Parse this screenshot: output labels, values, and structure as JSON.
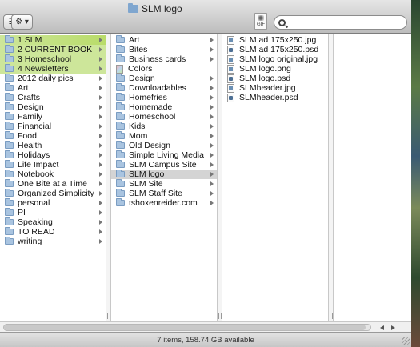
{
  "window": {
    "title": "SLM logo",
    "status": "7 items, 158.74 GB available"
  },
  "toolbar": {
    "view_label": "☰ ▾",
    "action_label": "⚙ ▾",
    "preview_badge": "GIF",
    "search_placeholder": "",
    "search_value": ""
  },
  "column1": {
    "items": [
      {
        "label": "1 SLM",
        "kind": "folder",
        "selected": true,
        "color": "green",
        "arrow": true
      },
      {
        "label": "2 CURRENT BOOK",
        "kind": "folder",
        "color": "green",
        "arrow": true
      },
      {
        "label": "3 Homeschool",
        "kind": "folder",
        "color": "green",
        "arrow": true
      },
      {
        "label": "4 Newsletters",
        "kind": "folder",
        "color": "green",
        "arrow": true
      },
      {
        "label": "2012 daily pics",
        "kind": "folder",
        "arrow": true
      },
      {
        "label": "Art",
        "kind": "folder",
        "arrow": true
      },
      {
        "label": "Crafts",
        "kind": "folder",
        "arrow": true
      },
      {
        "label": "Design",
        "kind": "folder",
        "arrow": true
      },
      {
        "label": "Family",
        "kind": "folder",
        "arrow": true
      },
      {
        "label": "Financial",
        "kind": "folder",
        "arrow": true
      },
      {
        "label": "Food",
        "kind": "folder",
        "arrow": true
      },
      {
        "label": "Health",
        "kind": "folder",
        "arrow": true
      },
      {
        "label": "Holidays",
        "kind": "folder",
        "arrow": true
      },
      {
        "label": "Life Impact",
        "kind": "folder",
        "arrow": true
      },
      {
        "label": "Notebook",
        "kind": "folder",
        "arrow": true
      },
      {
        "label": "One Bite at a Time",
        "kind": "folder",
        "arrow": true
      },
      {
        "label": "Organized Simplicity",
        "kind": "folder",
        "arrow": true
      },
      {
        "label": "personal",
        "kind": "folder",
        "arrow": true
      },
      {
        "label": "PI",
        "kind": "folder",
        "arrow": true
      },
      {
        "label": "Speaking",
        "kind": "folder",
        "arrow": true
      },
      {
        "label": "TO READ",
        "kind": "folder",
        "arrow": true
      },
      {
        "label": "writing",
        "kind": "folder",
        "arrow": true
      }
    ]
  },
  "column2": {
    "items": [
      {
        "label": "Art",
        "kind": "folder",
        "arrow": true
      },
      {
        "label": "Bites",
        "kind": "folder",
        "arrow": true
      },
      {
        "label": "Business cards",
        "kind": "folder",
        "arrow": true
      },
      {
        "label": "Colors",
        "kind": "colors",
        "arrow": false
      },
      {
        "label": "Design",
        "kind": "folder",
        "arrow": true
      },
      {
        "label": "Downloadables",
        "kind": "folder",
        "arrow": true
      },
      {
        "label": "Homefries",
        "kind": "folder",
        "arrow": true
      },
      {
        "label": "Homemade",
        "kind": "folder",
        "arrow": true
      },
      {
        "label": "Homeschool",
        "kind": "folder",
        "arrow": true
      },
      {
        "label": "Kids",
        "kind": "folder",
        "arrow": true
      },
      {
        "label": "Mom",
        "kind": "folder",
        "arrow": true
      },
      {
        "label": "Old Design",
        "kind": "folder",
        "arrow": true
      },
      {
        "label": "Simple Living Media",
        "kind": "folder",
        "arrow": true
      },
      {
        "label": "SLM Campus Site",
        "kind": "folder",
        "arrow": true
      },
      {
        "label": "SLM logo",
        "kind": "folder",
        "selected": true,
        "arrow": true
      },
      {
        "label": "SLM Site",
        "kind": "folder",
        "arrow": true
      },
      {
        "label": "SLM Staff Site",
        "kind": "folder",
        "arrow": true
      },
      {
        "label": "tshoxenreider.com",
        "kind": "folder",
        "arrow": true
      }
    ]
  },
  "column3": {
    "items": [
      {
        "label": "SLM ad 175x250.jpg",
        "kind": "img"
      },
      {
        "label": "SLM ad 175x250.psd",
        "kind": "psd"
      },
      {
        "label": "SLM logo original.jpg",
        "kind": "img"
      },
      {
        "label": "SLM logo.png",
        "kind": "img"
      },
      {
        "label": "SLM logo.psd",
        "kind": "psd"
      },
      {
        "label": "SLMheader.jpg",
        "kind": "img"
      },
      {
        "label": "SLMheader.psd",
        "kind": "psd"
      }
    ]
  },
  "colors": {
    "label_highlight": "#cde69a",
    "selection_gray": "#d4d4d4",
    "folder_blue": "#a9c4e0"
  }
}
